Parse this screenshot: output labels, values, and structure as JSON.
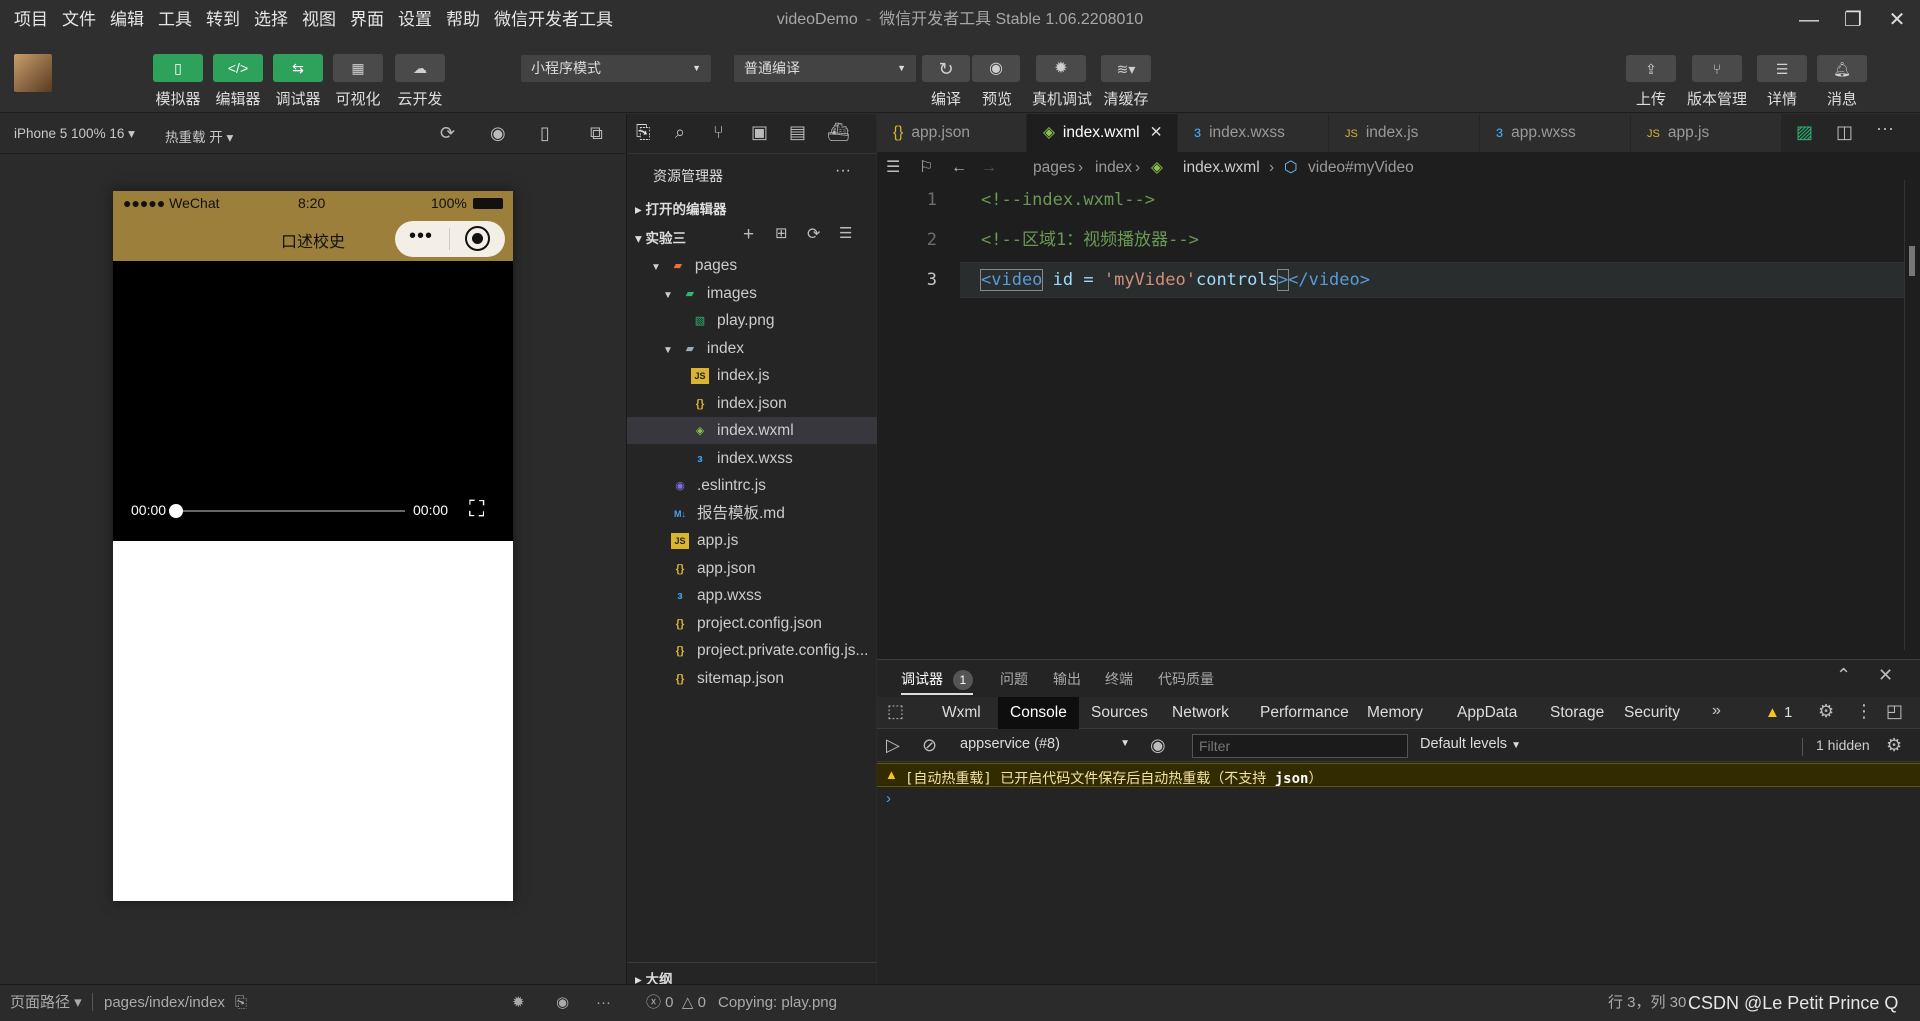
{
  "menu": [
    "项目",
    "文件",
    "编辑",
    "工具",
    "转到",
    "选择",
    "视图",
    "界面",
    "设置",
    "帮助",
    "微信开发者工具"
  ],
  "window": {
    "app": "videoDemo",
    "subtitle": "微信开发者工具 Stable 1.06.2208010"
  },
  "toolbar": {
    "simulator": "模拟器",
    "editor": "编辑器",
    "debugger": "调试器",
    "visual": "可视化",
    "cloud": "云开发",
    "mode_select": "小程序模式",
    "compile_select": "普通编译",
    "compile": "编译",
    "preview": "预览",
    "remote_debug": "真机调试",
    "clear_cache": "清缓存",
    "upload": "上传",
    "version": "版本管理",
    "details": "详情",
    "messages": "消息"
  },
  "sim_bar": {
    "device": "iPhone 5 100% 16",
    "hotreload": "热重载 开"
  },
  "phone": {
    "carrier": "●●●●● WeChat",
    "time": "8:20",
    "battery": "100%",
    "nav_title": "口述校史",
    "video_current": "00:00",
    "video_duration": "00:00"
  },
  "explorer": {
    "title": "资源管理器",
    "open_editors": "打开的编辑器",
    "project": "实验三",
    "outline": "大纲",
    "items": [
      {
        "label": "pages",
        "type": "folder-open"
      },
      {
        "label": "images",
        "type": "folder-open"
      },
      {
        "label": "play.png",
        "type": "image"
      },
      {
        "label": "index",
        "type": "folder-open"
      },
      {
        "label": "index.js",
        "type": "js"
      },
      {
        "label": "index.json",
        "type": "json"
      },
      {
        "label": "index.wxml",
        "type": "wxml"
      },
      {
        "label": "index.wxss",
        "type": "wxss"
      },
      {
        "label": ".eslintrc.js",
        "type": "eslint"
      },
      {
        "label": "报告模板.md",
        "type": "md"
      },
      {
        "label": "app.js",
        "type": "js"
      },
      {
        "label": "app.json",
        "type": "json"
      },
      {
        "label": "app.wxss",
        "type": "wxss"
      },
      {
        "label": "project.config.json",
        "type": "json"
      },
      {
        "label": "project.private.config.js...",
        "type": "json"
      },
      {
        "label": "sitemap.json",
        "type": "json"
      }
    ]
  },
  "tabs": [
    "app.json",
    "index.wxml",
    "index.wxss",
    "index.js",
    "app.wxss",
    "app.js"
  ],
  "breadcrumb": [
    "pages",
    "index",
    "index.wxml",
    "video#myVideo"
  ],
  "code": {
    "line1": "<!--index.wxml-->",
    "line2": "<!--区域1：视频播放器-->",
    "l3_open": "<video",
    "l3_attr": " id = ",
    "l3_val": "'myVideo'",
    "l3_ctrl": "controls",
    "l3_gt": ">",
    "l3_close": "</video>"
  },
  "panel": {
    "tabs": [
      "调试器",
      "问题",
      "输出",
      "终端",
      "代码质量"
    ],
    "debug_badge": "1",
    "devtabs": [
      "Wxml",
      "Console",
      "Sources",
      "Network",
      "Performance",
      "Memory",
      "AppData",
      "Storage",
      "Security"
    ],
    "warn_count": "1",
    "context": "appservice (#8)",
    "filter_placeholder": "Filter",
    "levels": "Default levels",
    "hidden": "1 hidden",
    "warning_text": "[自动热重载] 已开启代码文件保存后自动热重载（不支持 ",
    "warning_json": "json",
    "warning_end": "）"
  },
  "status": {
    "page_path_label": "页面路径",
    "page_path": "pages/index/index",
    "errors": "0",
    "warnings": "0",
    "copying": "Copying: play.png",
    "cursor": "行 3，列 30",
    "watermark": "CSDN @Le Petit Prince Q"
  }
}
